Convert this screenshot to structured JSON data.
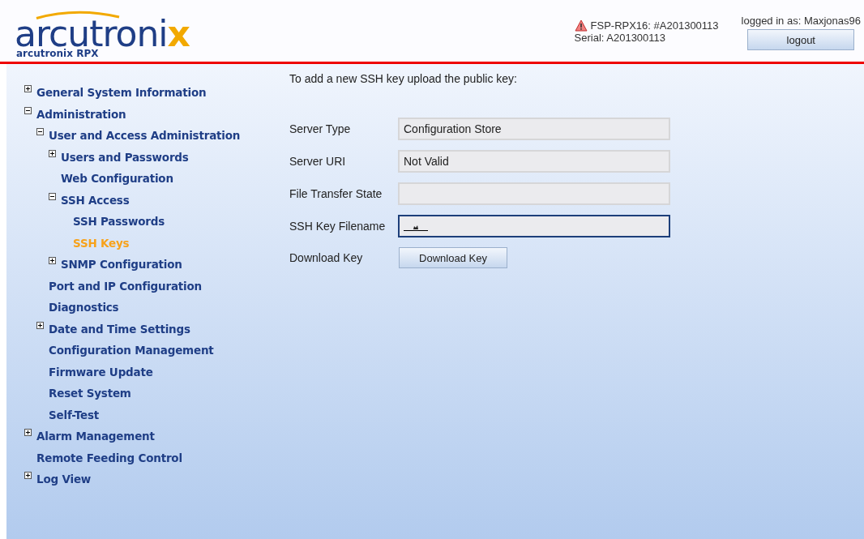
{
  "header": {
    "logo": {
      "main": "arcutroni",
      "accent": "x",
      "subtitle": "arcutronix RPX"
    },
    "device": {
      "alarm": true,
      "name": "FSP-RPX16: #A201300113",
      "serial": "Serial: A201300113"
    },
    "user": {
      "label": "logged in as: Maxjonas96",
      "logout": "logout"
    }
  },
  "sidebar": {
    "items": [
      {
        "label": "General System Information",
        "expanded": false,
        "selected": false
      },
      {
        "label": "Administration",
        "expanded": true,
        "selected": false,
        "children": [
          {
            "label": "User and Access Administration",
            "expanded": true,
            "selected": false,
            "children": [
              {
                "label": "Users and Passwords",
                "expanded": false,
                "selected": false
              },
              {
                "label": "Web Configuration",
                "selected": false
              },
              {
                "label": "SSH Access",
                "expanded": true,
                "selected": false,
                "children": [
                  {
                    "label": "SSH Passwords",
                    "selected": false
                  },
                  {
                    "label": "SSH Keys",
                    "selected": true
                  }
                ]
              },
              {
                "label": "SNMP Configuration",
                "expanded": false,
                "selected": false
              }
            ]
          },
          {
            "label": "Port and IP Configuration",
            "selected": false
          },
          {
            "label": "Diagnostics",
            "selected": false
          },
          {
            "label": "Date and Time Settings",
            "expanded": false,
            "selected": false
          },
          {
            "label": "Configuration Management",
            "selected": false
          },
          {
            "label": "Firmware Update",
            "selected": false
          },
          {
            "label": "Reset System",
            "selected": false
          },
          {
            "label": "Self-Test",
            "selected": false
          }
        ]
      },
      {
        "label": "Alarm Management",
        "expanded": false,
        "selected": false
      },
      {
        "label": "Remote Feeding Control",
        "selected": false
      },
      {
        "label": "Log View",
        "expanded": false,
        "selected": false
      }
    ]
  },
  "content": {
    "intro": "To add a new SSH key upload the public key:",
    "fields": [
      {
        "kind": "field",
        "label": "Server Type",
        "value": "Configuration Store",
        "focused": false
      },
      {
        "kind": "field",
        "label": "Server URI",
        "value": "Not Valid",
        "focused": false
      },
      {
        "kind": "field",
        "label": "File Transfer State",
        "focused": false
      },
      {
        "kind": "field",
        "label": "SSH Key Filename",
        "focused": true,
        "cursor": true
      },
      {
        "kind": "button",
        "label": "Download Key",
        "button": "Download Key"
      }
    ]
  }
}
